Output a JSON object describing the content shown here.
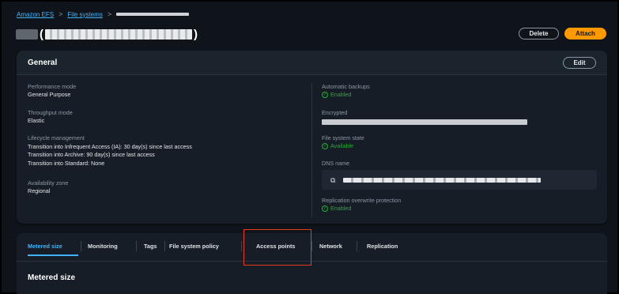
{
  "breadcrumb": {
    "items": [
      "Amazon EFS",
      "File systems"
    ],
    "separator": ">"
  },
  "header": {
    "open_paren": "(",
    "close_paren": ")",
    "delete_label": "Delete",
    "attach_label": "Attach"
  },
  "general": {
    "title": "General",
    "edit_label": "Edit",
    "left": {
      "performance_mode": {
        "label": "Performance mode",
        "value": "General Purpose"
      },
      "throughput_mode": {
        "label": "Throughput mode",
        "value": "Elastic"
      },
      "lifecycle": {
        "label": "Lifecycle management",
        "lines": [
          "Transition into Infrequent Access (IA): 30 day(s) since last access",
          "Transition into Archive: 90 day(s) since last access",
          "Transition into Standard: None"
        ]
      },
      "availability_zone": {
        "label": "Availability zone",
        "value": "Regional"
      }
    },
    "right": {
      "automatic_backups": {
        "label": "Automatic backups",
        "value": "Enabled"
      },
      "encrypted": {
        "label": "Encrypted"
      },
      "file_system_state": {
        "label": "File system state",
        "value": "Available"
      },
      "dns_name": {
        "label": "DNS name"
      },
      "replication_overwrite": {
        "label": "Replication overwrite protection",
        "value": "Enabled"
      }
    }
  },
  "tabs": {
    "items": [
      "Metered size",
      "Monitoring",
      "Tags",
      "File system policy",
      "Access points",
      "Network",
      "Replication"
    ],
    "active": "Metered size"
  },
  "metered": {
    "title": "Metered size"
  },
  "colors": {
    "accent": "#42b4ff",
    "primary_button": "#ff9900",
    "success": "#29ad32",
    "highlight": "#e83b1e"
  },
  "icons": [
    "chevron-right-icon",
    "check-circle-icon",
    "copy-icon"
  ]
}
